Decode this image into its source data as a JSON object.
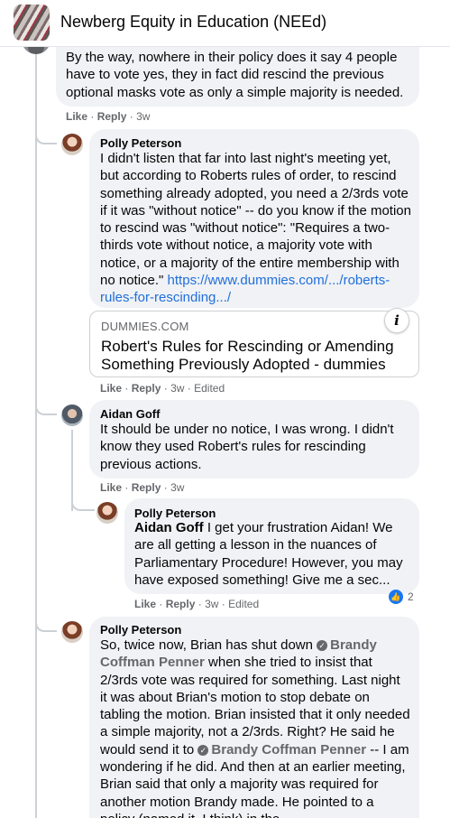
{
  "header": {
    "group_name": "Newberg Equity in Education (NEEd)"
  },
  "comments": [
    {
      "text": "By the way, nowhere in their policy does it say 4 people have to vote yes, they in fact did rescind the previous optional masks vote as only a simple majority is needed.",
      "actions": {
        "like": "Like",
        "reply": "Reply",
        "time": "3w"
      }
    },
    {
      "author": "Polly Peterson",
      "text": "I didn't listen that far into last night's meeting yet, but according to Roberts rules of order, to rescind something already adopted, you need a 2/3rds vote if it was \"without notice\" -- do you know if the motion to rescind was \"without notice\": \"Requires a two-thirds vote without notice, a majority vote with notice, or a majority of the entire membership with no notice.\"",
      "link_text": "https://www.dummies.com/.../roberts-rules-for-rescinding.../",
      "link_card": {
        "domain": "DUMMIES.COM",
        "title": "Robert's Rules for Rescinding or Amending Something Previously Adopted - dummies",
        "info_icon": "info-icon"
      },
      "actions": {
        "like": "Like",
        "reply": "Reply",
        "time": "3w",
        "edited": "Edited"
      }
    },
    {
      "author": "Aidan Goff",
      "text": "It should be under no notice, I was wrong. I didn't know they used Robert's rules for rescinding previous actions.",
      "actions": {
        "like": "Like",
        "reply": "Reply",
        "time": "3w"
      }
    },
    {
      "author": "Polly Peterson",
      "mention": "Aidan Goff",
      "text": "I get your frustration Aidan! We are all getting a lesson in the nuances of Parliamentary Procedure! However, you may have exposed something! Give me a sec...",
      "actions": {
        "like": "Like",
        "reply": "Reply",
        "time": "3w",
        "edited": "Edited"
      },
      "reaction": {
        "icon": "thumbs-up-icon",
        "count": "2"
      }
    },
    {
      "author": "Polly Peterson",
      "text_parts": [
        "So, twice now, Brian has shut down ",
        "Brandy Coffman Penner",
        " when she tried to insist that 2/3rds vote was required for something. Last night it was about Brian's motion to stop debate on tabling the motion. Brian insisted that it only needed a simple majority, not a 2/3rds. Right? He said he would send it to ",
        "Brandy Coffman Penner",
        " -- I am wondering if he did. And then at an earlier meeting, Brian said that only a majority was required for another motion Brandy made. He pointed to a policy (named it, I think) in the"
      ]
    }
  ],
  "separator": "·",
  "colors": {
    "bubble": "#f0f2f5",
    "meta_text": "#65676b",
    "link": "#216fdb",
    "like_blue": "#1877f2"
  }
}
